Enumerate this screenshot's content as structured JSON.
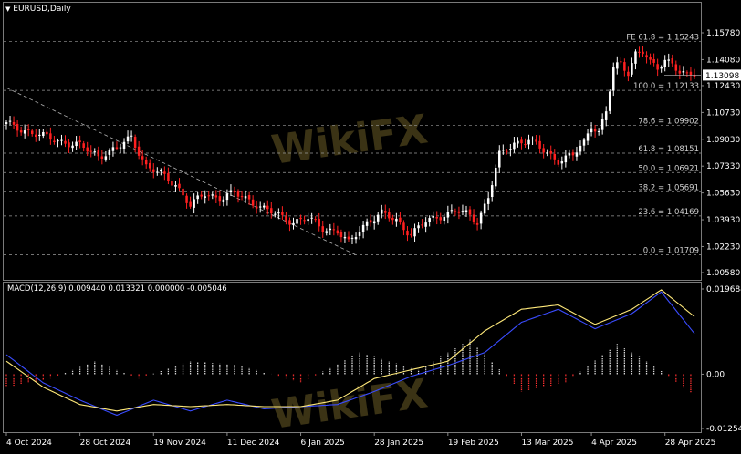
{
  "symbol_label": "EURUSD,Daily",
  "macd_label": "MACD(12,26,9) 0.009440 0.013321 0.000000 -0.005046",
  "watermark": "WikiFX",
  "colors": {
    "background": "#000000",
    "bull_candle": "#ffffff",
    "bear_candle": "#ff2020",
    "macd_line": "#3a4cff",
    "signal_line": "#ffe97a",
    "histogram_positive": "#d8d8d8",
    "histogram_negative": "#ff3030",
    "grid": "#2a2a2a",
    "fib_line": "#9a9a9a",
    "trendline": "#b0b0b0"
  },
  "chart_data": [
    {
      "type": "candlestick",
      "title": "EURUSD,Daily",
      "x_tick_labels": [
        "4 Oct 2024",
        "28 Oct 2024",
        "19 Nov 2024",
        "11 Dec 2024",
        "6 Jan 2025",
        "28 Jan 2025",
        "19 Feb 2025",
        "13 Mar 2025",
        "4 Apr 2025",
        "28 Apr 2025"
      ],
      "y_tick_labels": [
        "1.15780",
        "1.14080",
        "1.12430",
        "1.10730",
        "1.09030",
        "1.07330",
        "1.05630",
        "1.03930",
        "1.02230",
        "1.00580"
      ],
      "ylim": [
        1.0058,
        1.1578
      ],
      "current_price": "1.13098",
      "close_path": [
        {
          "x": 0,
          "y": 1.1
        },
        {
          "x": 10,
          "y": 1.092
        },
        {
          "x": 20,
          "y": 1.086
        },
        {
          "x": 25,
          "y": 1.08
        },
        {
          "x": 30,
          "y": 1.084
        },
        {
          "x": 34,
          "y": 1.092
        },
        {
          "x": 38,
          "y": 1.073
        },
        {
          "x": 42,
          "y": 1.068
        },
        {
          "x": 46,
          "y": 1.062
        },
        {
          "x": 50,
          "y": 1.048
        },
        {
          "x": 54,
          "y": 1.056
        },
        {
          "x": 58,
          "y": 1.053
        },
        {
          "x": 62,
          "y": 1.056
        },
        {
          "x": 66,
          "y": 1.052
        },
        {
          "x": 70,
          "y": 1.046
        },
        {
          "x": 74,
          "y": 1.042
        },
        {
          "x": 78,
          "y": 1.038
        },
        {
          "x": 82,
          "y": 1.04
        },
        {
          "x": 86,
          "y": 1.034
        },
        {
          "x": 90,
          "y": 1.032
        },
        {
          "x": 93,
          "y": 1.024
        },
        {
          "x": 95,
          "y": 1.03
        },
        {
          "x": 98,
          "y": 1.038
        },
        {
          "x": 102,
          "y": 1.043
        },
        {
          "x": 106,
          "y": 1.039
        },
        {
          "x": 110,
          "y": 1.03
        },
        {
          "x": 114,
          "y": 1.038
        },
        {
          "x": 118,
          "y": 1.042
        },
        {
          "x": 122,
          "y": 1.045
        },
        {
          "x": 126,
          "y": 1.042
        },
        {
          "x": 128,
          "y": 1.038
        },
        {
          "x": 131,
          "y": 1.054
        },
        {
          "x": 134,
          "y": 1.08
        },
        {
          "x": 138,
          "y": 1.088
        },
        {
          "x": 142,
          "y": 1.09
        },
        {
          "x": 146,
          "y": 1.083
        },
        {
          "x": 150,
          "y": 1.077
        },
        {
          "x": 154,
          "y": 1.08
        },
        {
          "x": 157,
          "y": 1.088
        },
        {
          "x": 159,
          "y": 1.1
        },
        {
          "x": 161,
          "y": 1.095
        },
        {
          "x": 163,
          "y": 1.108
        },
        {
          "x": 165,
          "y": 1.135
        },
        {
          "x": 167,
          "y": 1.138
        },
        {
          "x": 169,
          "y": 1.133
        },
        {
          "x": 171,
          "y": 1.145
        },
        {
          "x": 173,
          "y": 1.146
        },
        {
          "x": 175,
          "y": 1.138
        },
        {
          "x": 177,
          "y": 1.135
        },
        {
          "x": 179,
          "y": 1.141
        },
        {
          "x": 181,
          "y": 1.139
        },
        {
          "x": 183,
          "y": 1.133
        },
        {
          "x": 185,
          "y": 1.13
        },
        {
          "x": 187,
          "y": 1.131
        }
      ],
      "fibonacci_levels": [
        {
          "label": "FE 61.8 = 1.15243",
          "price": 1.15243
        },
        {
          "label": "100.0 = 1.12133",
          "price": 1.12133
        },
        {
          "label": "78.6 = 1.09902",
          "price": 1.09902
        },
        {
          "label": "61.8 = 1.08151",
          "price": 1.08151
        },
        {
          "label": "50.0 = 1.06921",
          "price": 1.06921
        },
        {
          "label": "38.2 = 1.05691",
          "price": 1.05691
        },
        {
          "label": "23.6 = 1.04169",
          "price": 1.04169
        },
        {
          "label": "0.0 = 1.01709",
          "price": 1.01709
        }
      ],
      "trendline": [
        {
          "x": 0,
          "y": 1.123
        },
        {
          "x": 95,
          "y": 1.017
        }
      ]
    },
    {
      "type": "line",
      "title": "MACD(12,26,9)",
      "y_tick_labels": [
        "0.019684",
        "0.00",
        "-0.012547"
      ],
      "ylim": [
        -0.012547,
        0.019684
      ],
      "series": [
        {
          "name": "MACD",
          "points": [
            {
              "x": 0,
              "y": 0.0045
            },
            {
              "x": 10,
              "y": -0.002
            },
            {
              "x": 20,
              "y": -0.006
            },
            {
              "x": 30,
              "y": -0.0095
            },
            {
              "x": 40,
              "y": -0.006
            },
            {
              "x": 50,
              "y": -0.0085
            },
            {
              "x": 60,
              "y": -0.006
            },
            {
              "x": 70,
              "y": -0.008
            },
            {
              "x": 80,
              "y": -0.0075
            },
            {
              "x": 90,
              "y": -0.007
            },
            {
              "x": 100,
              "y": -0.004
            },
            {
              "x": 110,
              "y": -0.0005
            },
            {
              "x": 120,
              "y": 0.002
            },
            {
              "x": 130,
              "y": 0.005
            },
            {
              "x": 140,
              "y": 0.012
            },
            {
              "x": 150,
              "y": 0.015
            },
            {
              "x": 160,
              "y": 0.0105
            },
            {
              "x": 170,
              "y": 0.014
            },
            {
              "x": 178,
              "y": 0.019
            },
            {
              "x": 187,
              "y": 0.0094
            }
          ]
        },
        {
          "name": "Signal",
          "points": [
            {
              "x": 0,
              "y": 0.003
            },
            {
              "x": 10,
              "y": -0.003
            },
            {
              "x": 20,
              "y": -0.007
            },
            {
              "x": 30,
              "y": -0.0085
            },
            {
              "x": 40,
              "y": -0.007
            },
            {
              "x": 50,
              "y": -0.0075
            },
            {
              "x": 60,
              "y": -0.007
            },
            {
              "x": 70,
              "y": -0.0075
            },
            {
              "x": 80,
              "y": -0.0075
            },
            {
              "x": 90,
              "y": -0.006
            },
            {
              "x": 100,
              "y": -0.001
            },
            {
              "x": 110,
              "y": 0.001
            },
            {
              "x": 120,
              "y": 0.003
            },
            {
              "x": 130,
              "y": 0.01
            },
            {
              "x": 140,
              "y": 0.015
            },
            {
              "x": 150,
              "y": 0.016
            },
            {
              "x": 160,
              "y": 0.0115
            },
            {
              "x": 170,
              "y": 0.015
            },
            {
              "x": 178,
              "y": 0.0195
            },
            {
              "x": 187,
              "y": 0.0133
            }
          ]
        }
      ],
      "histogram": [
        {
          "x": 0,
          "y": -0.003
        },
        {
          "x": 12,
          "y": -0.001
        },
        {
          "x": 24,
          "y": 0.003
        },
        {
          "x": 36,
          "y": -0.001
        },
        {
          "x": 50,
          "y": 0.003
        },
        {
          "x": 64,
          "y": 0.002
        },
        {
          "x": 80,
          "y": -0.002
        },
        {
          "x": 96,
          "y": 0.005
        },
        {
          "x": 112,
          "y": 0.001
        },
        {
          "x": 126,
          "y": 0.008
        },
        {
          "x": 140,
          "y": -0.004
        },
        {
          "x": 152,
          "y": -0.002
        },
        {
          "x": 166,
          "y": 0.007
        },
        {
          "x": 176,
          "y": 0.002
        },
        {
          "x": 187,
          "y": -0.005
        }
      ]
    }
  ]
}
